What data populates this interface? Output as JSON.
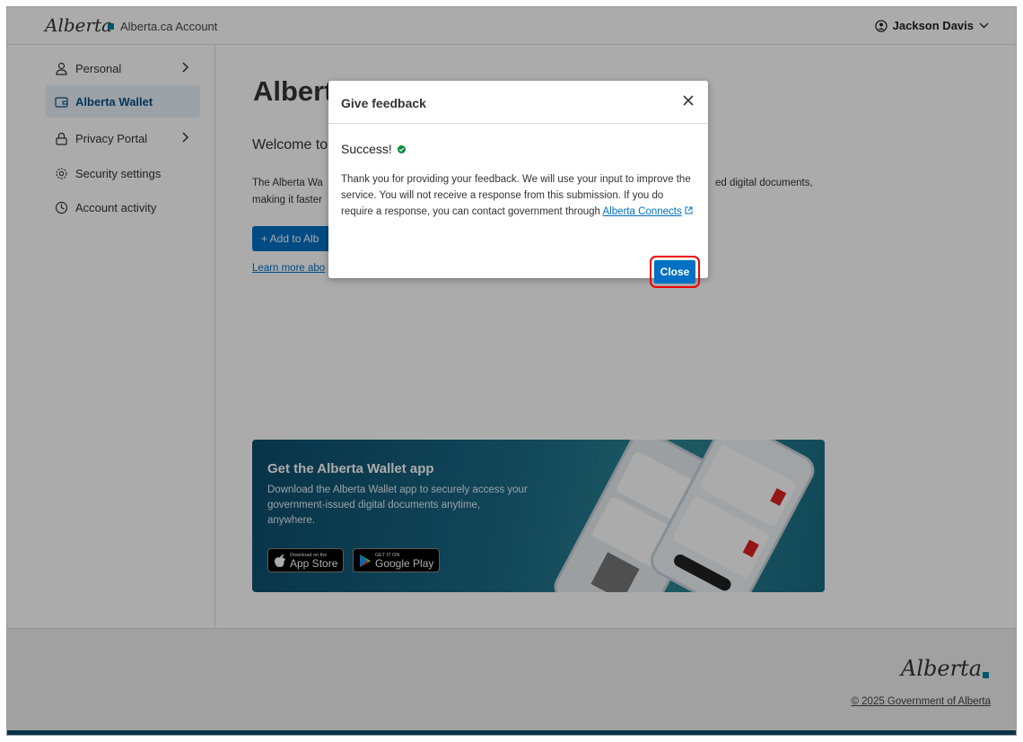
{
  "header": {
    "logo_text": "Alberta",
    "account_title": "Alberta.ca Account",
    "user_name": "Jackson Davis"
  },
  "sidebar": {
    "items": [
      {
        "label": "Personal"
      },
      {
        "label": "Alberta Wallet"
      },
      {
        "label": "Privacy Portal"
      },
      {
        "label": "Security settings"
      },
      {
        "label": "Account activity"
      }
    ]
  },
  "main": {
    "title_visible": "Albert",
    "welcome_visible": "Welcome to",
    "desc_line1_visible": "The Alberta Wa",
    "desc_line1_right": "ed digital documents,",
    "desc_line2_visible": "making it faster",
    "add_button_visible": "+ Add to Alb",
    "learn_more_visible": "Learn more abo"
  },
  "promo": {
    "title": "Get the Alberta Wallet app",
    "text": "Download the Alberta Wallet app to securely access your government-issued digital documents anytime, anywhere.",
    "app_store_small": "Download on the",
    "app_store_big": "App Store",
    "google_play_small": "GET IT ON",
    "google_play_big": "Google Play"
  },
  "footer": {
    "logo_text": "Alberta",
    "copyright": "© 2025 Government of Alberta"
  },
  "modal": {
    "title": "Give feedback",
    "success": "Success!",
    "body": "Thank you for providing your feedback. We will use your input to improve the service. You will not receive a response from this submission. If you do require a response, you can contact government through ",
    "link": "Alberta Connects",
    "close_label": "Close"
  }
}
